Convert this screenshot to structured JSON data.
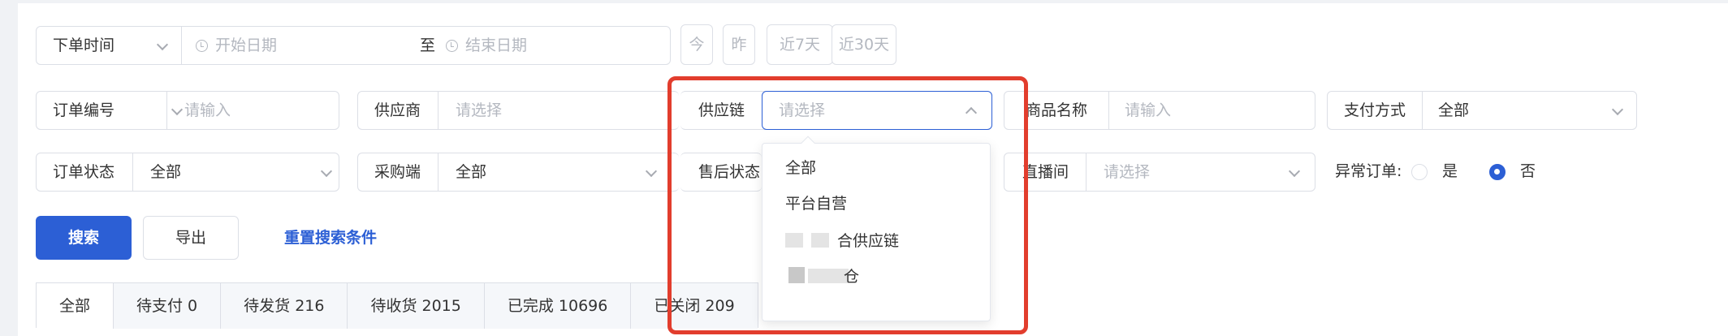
{
  "date_filter": {
    "type_label": "下单时间",
    "start_placeholder": "开始日期",
    "separator": "至",
    "end_placeholder": "结束日期"
  },
  "quick_dates": [
    "今",
    "昨",
    "近7天",
    "近30天"
  ],
  "filters_row1": {
    "order_no": {
      "label": "订单编号",
      "placeholder": "请输入"
    },
    "supplier": {
      "label": "供应商",
      "placeholder": "请选择"
    },
    "supply_chain": {
      "label": "供应链",
      "placeholder": "请选择"
    },
    "product_name": {
      "label": "商品名称",
      "placeholder": "请输入"
    },
    "payment_method": {
      "label": "支付方式",
      "value": "全部"
    }
  },
  "filters_row2": {
    "order_status": {
      "label": "订单状态",
      "value": "全部"
    },
    "purchaser": {
      "label": "采购端",
      "value": "全部"
    },
    "after_sales": {
      "label": "售后状态"
    },
    "live_room": {
      "label": "直播间",
      "placeholder": "请选择"
    },
    "abnormal_order": {
      "label": "异常订单:",
      "options": [
        "是",
        "否"
      ],
      "selected": "否"
    }
  },
  "actions": {
    "search": "搜索",
    "export": "导出",
    "reset": "重置搜索条件"
  },
  "tabs": [
    {
      "label": "全部",
      "active": true
    },
    {
      "label": "待支付 0"
    },
    {
      "label": "待发货 216"
    },
    {
      "label": "待收货 2015"
    },
    {
      "label": "已完成 10696"
    },
    {
      "label": "已关闭 209"
    }
  ],
  "supply_chain_dropdown": {
    "options": [
      "全部",
      "平台自营",
      "合供应链",
      "仓"
    ]
  },
  "colors": {
    "primary": "#2c5fd5",
    "annotation": "#e23d2d",
    "border": "#dcdfe6",
    "placeholder": "#b4b8c0"
  }
}
